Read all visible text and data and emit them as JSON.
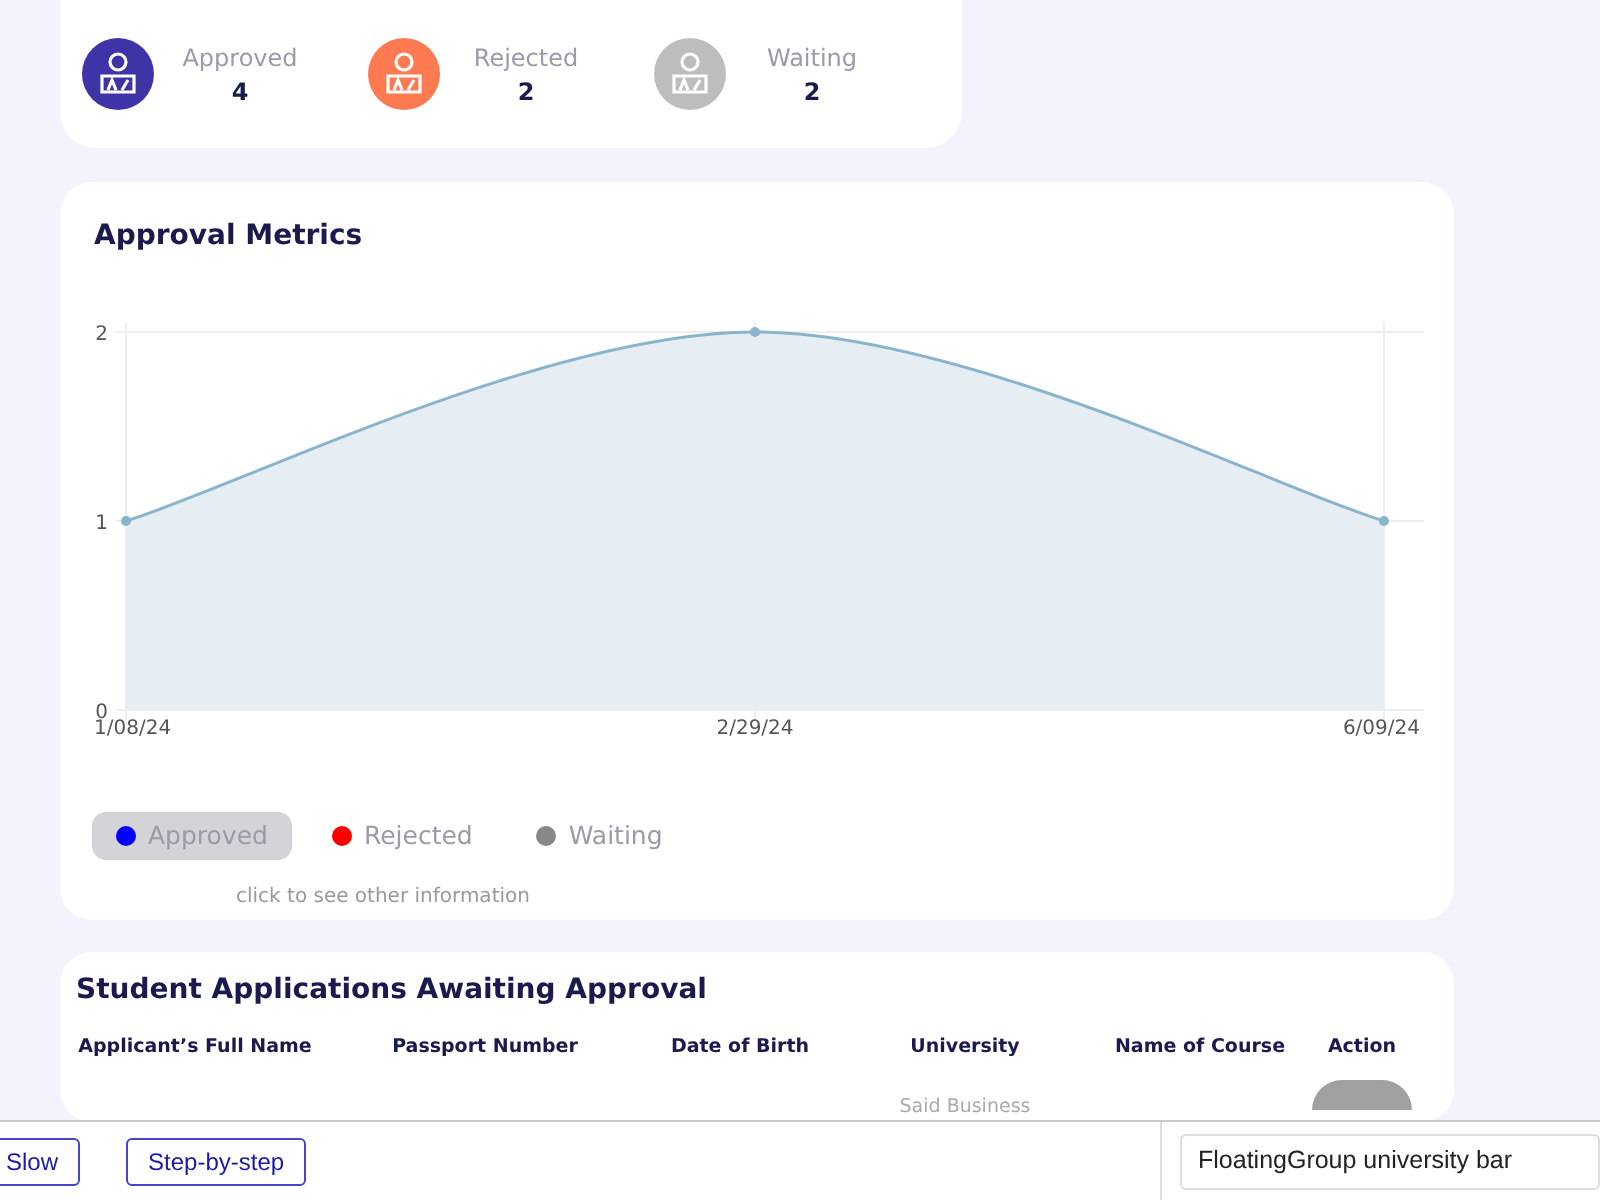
{
  "stats": [
    {
      "label": "Approved",
      "count": "4",
      "color": "#3f33a8"
    },
    {
      "label": "Rejected",
      "count": "2",
      "color": "#ff7a50"
    },
    {
      "label": "Waiting",
      "count": "2",
      "color": "#bdbdbd"
    }
  ],
  "metrics": {
    "title": "Approval Metrics",
    "chart_data": {
      "type": "area",
      "grid": true,
      "categories": [
        "1/08/24",
        "2/29/24",
        "6/09/24"
      ],
      "yticks": [
        0,
        1,
        2
      ],
      "ylim": [
        0,
        2
      ],
      "series": [
        {
          "color": "#8ab4cc",
          "values": [
            1,
            2,
            1
          ]
        }
      ]
    },
    "legend": [
      {
        "label": "Approved",
        "color": "#0000ff",
        "selected": true
      },
      {
        "label": "Rejected",
        "color": "#ff0000",
        "selected": false
      },
      {
        "label": "Waiting",
        "color": "#888888",
        "selected": false
      }
    ],
    "hint": "click to see other information"
  },
  "applications": {
    "title": "Student Applications Awaiting Approval",
    "columns": [
      "Applicant’s Full Name",
      "Passport Number",
      "Date of Birth",
      "University",
      "Name of Course",
      "Action"
    ],
    "rows": [
      {
        "university": "Said Business"
      }
    ]
  },
  "bottom_bar": {
    "buttons": [
      "Slow",
      "Step-by-step"
    ],
    "select": {
      "value": "FloatingGroup university bar"
    }
  }
}
